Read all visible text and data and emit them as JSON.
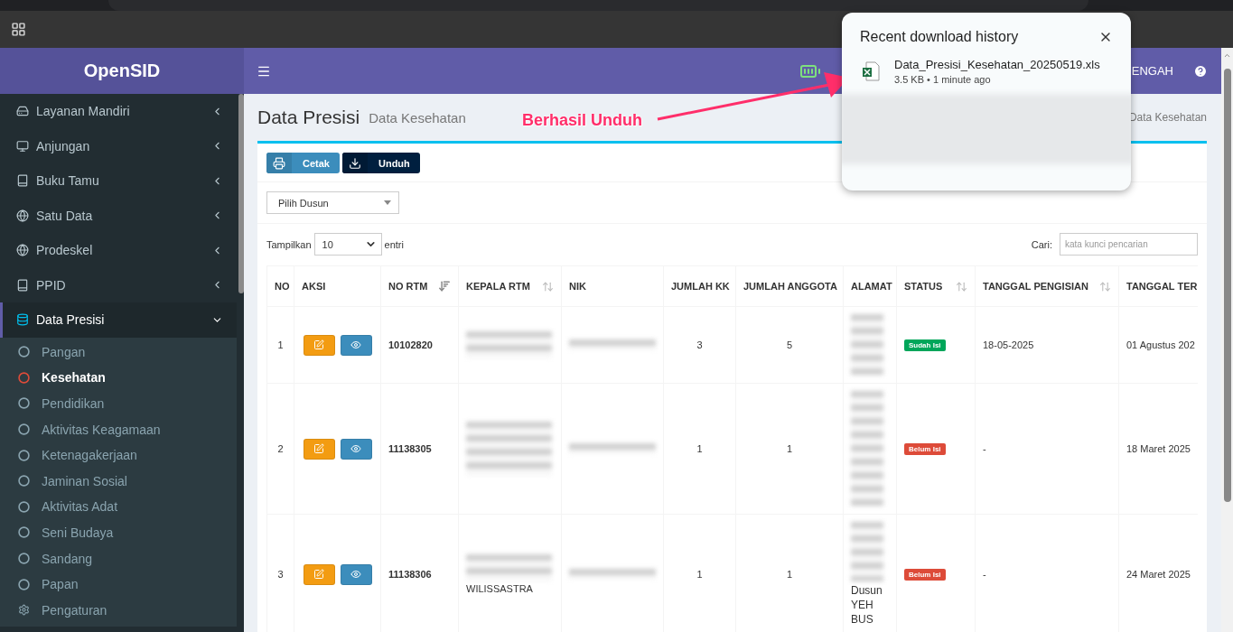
{
  "app": {
    "logo": "OpenSID"
  },
  "navbar": {
    "region": "ENGAH"
  },
  "sidebar": {
    "items": [
      {
        "label": "Layanan Mandiri",
        "expanded": false,
        "selected": false
      },
      {
        "label": "Anjungan",
        "expanded": false,
        "selected": false
      },
      {
        "label": "Buku Tamu",
        "expanded": false,
        "selected": false
      },
      {
        "label": "Satu Data",
        "expanded": false,
        "selected": false
      },
      {
        "label": "Prodeskel",
        "expanded": false,
        "selected": false
      },
      {
        "label": "PPID",
        "expanded": false,
        "selected": false
      },
      {
        "label": "Data Presisi",
        "expanded": true,
        "selected": true,
        "children": [
          {
            "label": "Pangan",
            "kind": "page",
            "selected": false
          },
          {
            "label": "Kesehatan",
            "kind": "page",
            "selected": true
          },
          {
            "label": "Pendidikan",
            "kind": "page",
            "selected": false
          },
          {
            "label": "Aktivitas Keagamaan",
            "kind": "page",
            "selected": false
          },
          {
            "label": "Ketenagakerjaan",
            "kind": "page",
            "selected": false
          },
          {
            "label": "Jaminan Sosial",
            "kind": "page",
            "selected": false
          },
          {
            "label": "Aktivitas Adat",
            "kind": "page",
            "selected": false
          },
          {
            "label": "Seni Budaya",
            "kind": "page",
            "selected": false
          },
          {
            "label": "Sandang",
            "kind": "page",
            "selected": false
          },
          {
            "label": "Papan",
            "kind": "page",
            "selected": false
          },
          {
            "label": "Pengaturan",
            "kind": "settings",
            "selected": false
          }
        ]
      }
    ]
  },
  "page": {
    "title": "Data Presisi",
    "subtitle": "Data Kesehatan",
    "breadcrumb": "Data Kesehatan"
  },
  "toolbar": {
    "buttons": [
      {
        "label": "Cetak",
        "kind": "print"
      },
      {
        "label": "Unduh",
        "kind": "download"
      }
    ]
  },
  "filter": {
    "value": "Pilih Dusun"
  },
  "table_controls": {
    "show_label": "Tampilkan",
    "page_size": "10",
    "entries_label": "entri",
    "search_label": "Cari:",
    "search_placeholder": "kata kunci pencarian"
  },
  "table": {
    "columns": [
      {
        "label": "NO"
      },
      {
        "label": "AKSI"
      },
      {
        "label": "NO RTM",
        "sorted": true
      },
      {
        "label": "KEPALA RTM",
        "sorted": false
      },
      {
        "label": "NIK"
      },
      {
        "label": "JUMLAH KK"
      },
      {
        "label": "JUMLAH ANGGOTA"
      },
      {
        "label": "ALAMAT"
      },
      {
        "label": "STATUS",
        "sorted": false
      },
      {
        "label": "TANGGAL PENGISIAN",
        "sorted": false
      },
      {
        "label": "TANGGAL TER"
      }
    ],
    "rows": [
      {
        "no": "1",
        "no_rtm": "10102820",
        "jumlah_kk": "3",
        "jumlah_anggota": "5",
        "status": {
          "label": "Sudah Isi",
          "color": "#00a65a"
        },
        "tanggal_pengisian": "18-05-2025",
        "tanggal_ter": "01 Agustus 202"
      },
      {
        "no": "2",
        "no_rtm": "11138305",
        "jumlah_kk": "1",
        "jumlah_anggota": "1",
        "status": {
          "label": "Belum Isi",
          "color": "#dd4b39"
        },
        "tanggal_pengisian": "-",
        "tanggal_ter": "18 Maret 2025"
      },
      {
        "no": "3",
        "no_rtm": "11138306",
        "kepala_rtm": "WILISSASTRA",
        "jumlah_kk": "1",
        "jumlah_anggota": "1",
        "alamat": "Dusun YEH BUS",
        "status": {
          "label": "Belum Isi",
          "color": "#dd4b39"
        },
        "tanggal_pengisian": "-",
        "tanggal_ter": "24 Maret 2025"
      }
    ]
  },
  "annotation": {
    "text": "Berhasil Unduh"
  },
  "download_popup": {
    "title": "Recent download history",
    "items": [
      {
        "name": "Data_Presisi_Kesehatan_20250519.xls",
        "meta": "3.5 KB • 1 minute ago"
      }
    ]
  }
}
